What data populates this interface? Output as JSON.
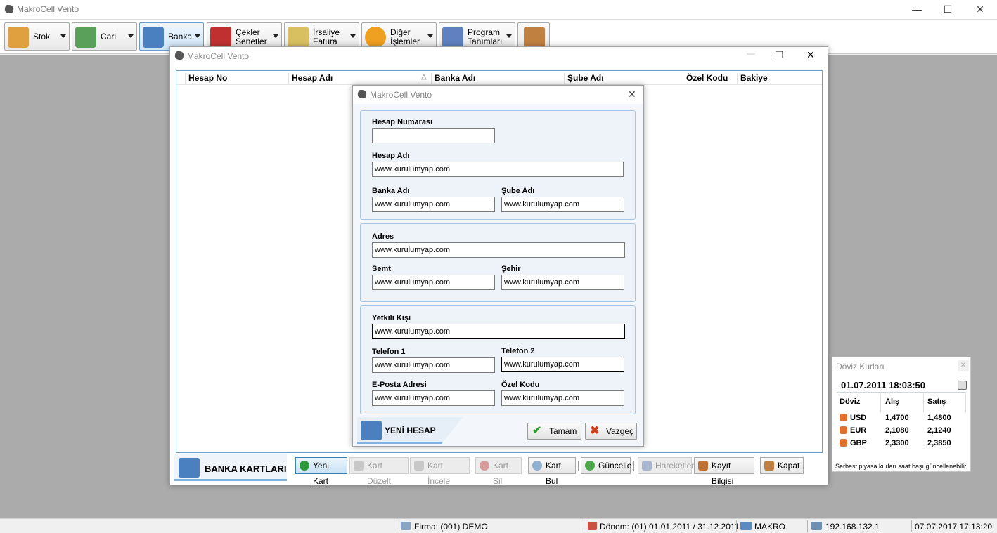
{
  "app": {
    "title": "MakroCell Vento"
  },
  "window_controls": {
    "minimize": "—",
    "maximize": "☐",
    "close": "✕"
  },
  "toolbar": [
    {
      "label1": "Stok",
      "label2": "",
      "icon": "box-icon",
      "color": "#e0a040"
    },
    {
      "label1": "Cari",
      "label2": "",
      "icon": "user-card-icon",
      "color": "#5aa05a"
    },
    {
      "label1": "Banka",
      "label2": "",
      "icon": "bank-icon",
      "color": "#4a7fc0"
    },
    {
      "label1": "Çekler",
      "label2": "Senetler",
      "icon": "calendar-icon",
      "color": "#c03030"
    },
    {
      "label1": "İrsaliye",
      "label2": "Fatura",
      "icon": "invoice-icon",
      "color": "#d8c060"
    },
    {
      "label1": "Diğer",
      "label2": "İşlemler",
      "icon": "gear-icon",
      "color": "#f0a020"
    },
    {
      "label1": "Program",
      "label2": "Tanımları",
      "icon": "checklist-icon",
      "color": "#6080c0"
    },
    {
      "label1": "",
      "label2": "",
      "icon": "exit-door-icon",
      "color": "#c08040"
    }
  ],
  "bank_window": {
    "title": "MakroCell Vento",
    "columns": [
      "Hesap No",
      "Hesap Adı",
      "Banka Adı",
      "Şube Adı",
      "Özel Kodu",
      "Bakiye"
    ],
    "sort_indicator": "△",
    "panel_label": "BANKA KARTLARI",
    "buttons": {
      "new": "Yeni Kart",
      "edit": "Kart Düzelt",
      "inspect": "Kart İncele",
      "delete": "Kart Sil",
      "find": "Kart Bul",
      "refresh": "Güncelle",
      "movements": "Hareketler",
      "record_info": "Kayıt Bilgisi",
      "close": "Kapat"
    }
  },
  "dialog": {
    "title": "MakroCell Vento",
    "fields": {
      "hesap_no": {
        "label": "Hesap Numarası",
        "value": ""
      },
      "hesap_adi": {
        "label": "Hesap Adı",
        "value": "www.kurulumyap.com"
      },
      "banka_adi": {
        "label": "Banka Adı",
        "value": "www.kurulumyap.com"
      },
      "sube_adi": {
        "label": "Şube Adı",
        "value": "www.kurulumyap.com"
      },
      "adres": {
        "label": "Adres",
        "value": "www.kurulumyap.com"
      },
      "semt": {
        "label": "Semt",
        "value": "www.kurulumyap.com"
      },
      "sehir": {
        "label": "Şehir",
        "value": "www.kurulumyap.com"
      },
      "yetkili": {
        "label": "Yetkili Kişi",
        "value": "www.kurulumyap.com"
      },
      "tel1": {
        "label": "Telefon 1",
        "value": "www.kurulumyap.com"
      },
      "tel2": {
        "label": "Telefon 2",
        "value": "www.kurulumyap.com"
      },
      "eposta": {
        "label": "E-Posta Adresi",
        "value": "www.kurulumyap.com"
      },
      "ozel_kodu": {
        "label": "Özel Kodu",
        "value": "www.kurulumyap.com"
      }
    },
    "footer_label": "YENİ HESAP",
    "ok_label": "Tamam",
    "cancel_label": "Vazgeç"
  },
  "currency": {
    "title": "Döviz Kurları",
    "datetime": "01.07.2011 18:03:50",
    "headers": [
      "Döviz",
      "Alış",
      "Satış"
    ],
    "rows": [
      {
        "code": "USD",
        "buy": "1,4700",
        "sell": "1,4800"
      },
      {
        "code": "EUR",
        "buy": "2,1080",
        "sell": "2,1240"
      },
      {
        "code": "GBP",
        "buy": "2,3300",
        "sell": "2,3850"
      }
    ],
    "note": "Serbest piyasa kurları saat başı güncellenebilir."
  },
  "status": {
    "firma": "Firma: (001) DEMO",
    "donem": "Dönem: (01) 01.01.2011 / 31.12.2011",
    "user": "MAKRO",
    "ip": "192.168.132.1",
    "datetime": "07.07.2017 17:13:20"
  }
}
